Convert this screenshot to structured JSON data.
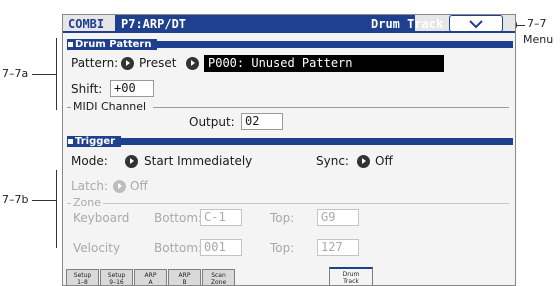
{
  "callouts": {
    "menu_ref": "7–7",
    "menu_label": "Menu",
    "pattern_ref": "7–7a",
    "trigger_ref": "7–7b"
  },
  "header": {
    "mode": "COMBI",
    "page": "P7:ARP/DT",
    "title": "Drum Track",
    "menu_icon": "chevron-down-icon"
  },
  "drum_pattern": {
    "section_title": "Drum Pattern",
    "pattern_label": "Pattern:",
    "pattern_bank": "Preset",
    "pattern_value": "P000: Unused Pattern",
    "shift_label": "Shift:",
    "shift_value": "+00",
    "midi_channel_label": "MIDI Channel",
    "output_label": "Output:",
    "output_value": "02"
  },
  "trigger": {
    "section_title": "Trigger",
    "mode_label": "Mode:",
    "mode_value": "Start Immediately",
    "sync_label": "Sync:",
    "sync_value": "Off",
    "latch_label": "Latch:",
    "latch_value": "Off",
    "zone_label": "Zone",
    "keyboard_label": "Keyboard",
    "velocity_label": "Velocity",
    "bottom_label": "Bottom:",
    "top_label": "Top:",
    "keyboard_bottom": "C-1",
    "keyboard_top": "G9",
    "velocity_bottom": "001",
    "velocity_top": "127"
  },
  "tabs": [
    {
      "line1": "Setup",
      "line2": "1–8"
    },
    {
      "line1": "Setup",
      "line2": "9–16"
    },
    {
      "line1": "ARP",
      "line2": "A"
    },
    {
      "line1": "ARP",
      "line2": "B"
    },
    {
      "line1": "Scan",
      "line2": "Zone"
    },
    {
      "line1": "Drum",
      "line2": "Track"
    }
  ],
  "colors": {
    "accent": "#1f3f8f",
    "screen_bg": "#f4f4f4",
    "disabled_text": "#a9a9a9"
  }
}
